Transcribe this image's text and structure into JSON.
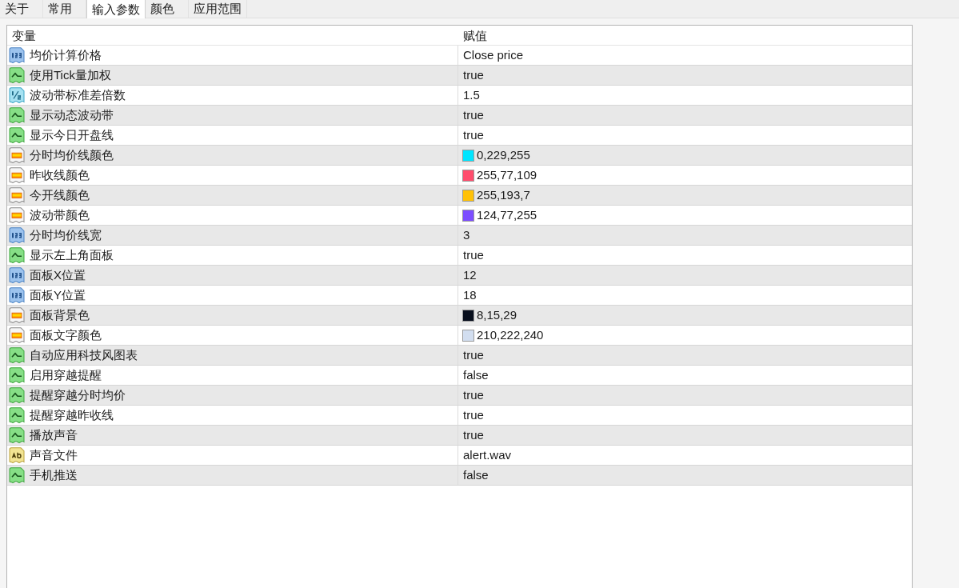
{
  "tabs": [
    {
      "label": "关于",
      "selected": false
    },
    {
      "label": "常用",
      "selected": false
    },
    {
      "label": "输入参数",
      "selected": true
    },
    {
      "label": "颜色",
      "selected": false
    },
    {
      "label": "应用范围",
      "selected": false
    }
  ],
  "table": {
    "columns": [
      "变量",
      "赋值"
    ],
    "rows": [
      {
        "kind": "int",
        "name": "均价计算价格",
        "value": "Close price"
      },
      {
        "kind": "bool",
        "name": "使用Tick量加权",
        "value": "true"
      },
      {
        "kind": "double",
        "name": "波动带标准差倍数",
        "value": "1.5"
      },
      {
        "kind": "bool",
        "name": "显示动态波动带",
        "value": "true"
      },
      {
        "kind": "bool",
        "name": "显示今日开盘线",
        "value": "true"
      },
      {
        "kind": "color",
        "name": "分时均价线颜色",
        "value": "0,229,255",
        "color": "#00e5ff"
      },
      {
        "kind": "color",
        "name": "昨收线颜色",
        "value": "255,77,109",
        "color": "#ff4d6d"
      },
      {
        "kind": "color",
        "name": "今开线颜色",
        "value": "255,193,7",
        "color": "#ffc107"
      },
      {
        "kind": "color",
        "name": "波动带颜色",
        "value": "124,77,255",
        "color": "#7c4dff"
      },
      {
        "kind": "int",
        "name": "分时均价线宽",
        "value": "3"
      },
      {
        "kind": "bool",
        "name": "显示左上角面板",
        "value": "true"
      },
      {
        "kind": "int",
        "name": "面板X位置",
        "value": "12"
      },
      {
        "kind": "int",
        "name": "面板Y位置",
        "value": "18"
      },
      {
        "kind": "color",
        "name": "面板背景色",
        "value": "8,15,29",
        "color": "#080f1d"
      },
      {
        "kind": "color",
        "name": "面板文字颜色",
        "value": "210,222,240",
        "color": "#d2def0"
      },
      {
        "kind": "bool",
        "name": "自动应用科技风图表",
        "value": "true"
      },
      {
        "kind": "bool",
        "name": "启用穿越提醒",
        "value": "false"
      },
      {
        "kind": "bool",
        "name": "提醒穿越分时均价",
        "value": "true"
      },
      {
        "kind": "bool",
        "name": "提醒穿越昨收线",
        "value": "true"
      },
      {
        "kind": "bool",
        "name": "播放声音",
        "value": "true"
      },
      {
        "kind": "string",
        "name": "声音文件",
        "value": "alert.wav"
      },
      {
        "kind": "bool",
        "name": "手机推送",
        "value": "false"
      }
    ]
  }
}
